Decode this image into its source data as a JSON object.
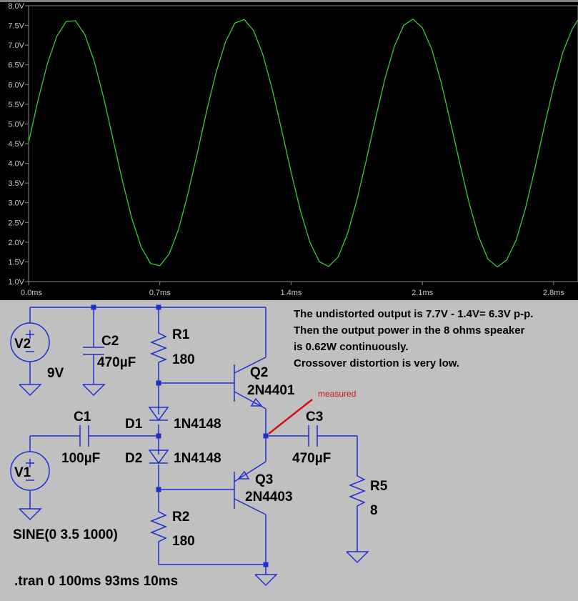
{
  "waveform": {
    "y_ticks": [
      "8.0V",
      "7.5V",
      "7.0V",
      "6.5V",
      "6.0V",
      "5.5V",
      "5.0V",
      "4.5V",
      "4.0V",
      "3.5V",
      "3.0V",
      "2.5V",
      "2.0V",
      "1.5V",
      "1.0V"
    ],
    "x_ticks": [
      "0.0ms",
      "0.7ms",
      "1.4ms",
      "2.1ms",
      "2.8ms"
    ]
  },
  "chart_data": {
    "type": "line",
    "title": "",
    "xlabel": "",
    "ylabel": "",
    "xlim": [
      0,
      2.93
    ],
    "ylim": [
      1.0,
      8.0
    ],
    "x_unit": "ms",
    "y_unit": "V",
    "trace_color": "#3cc83c",
    "background": "#000000",
    "series": [
      {
        "x": [
          0.0,
          0.05,
          0.1,
          0.15,
          0.2,
          0.25,
          0.3,
          0.35,
          0.4,
          0.45,
          0.5,
          0.55,
          0.6,
          0.65,
          0.7,
          0.75,
          0.8,
          0.85,
          0.9,
          0.95,
          1.0,
          1.05,
          1.1,
          1.15,
          1.2,
          1.25,
          1.3,
          1.35,
          1.4,
          1.45,
          1.5,
          1.55,
          1.6,
          1.65,
          1.7,
          1.75,
          1.8,
          1.85,
          1.9,
          1.95,
          2.0,
          2.05,
          2.1,
          2.15,
          2.2,
          2.25,
          2.3,
          2.35,
          2.4,
          2.45,
          2.5,
          2.55,
          2.6,
          2.65,
          2.7,
          2.75,
          2.8,
          2.85,
          2.9,
          2.93
        ],
        "y": [
          4.53,
          5.59,
          6.52,
          7.22,
          7.6,
          7.62,
          7.27,
          6.59,
          5.67,
          4.62,
          3.57,
          2.61,
          1.88,
          1.46,
          1.4,
          1.7,
          2.33,
          3.23,
          4.26,
          5.33,
          6.31,
          7.08,
          7.56,
          7.65,
          7.37,
          6.75,
          5.87,
          4.84,
          3.78,
          2.79,
          2.0,
          1.51,
          1.38,
          1.62,
          2.2,
          3.05,
          4.06,
          5.13,
          6.14,
          6.96,
          7.5,
          7.66,
          7.44,
          6.9,
          6.06,
          5.04,
          3.99,
          2.98,
          2.14,
          1.57,
          1.37,
          1.55,
          2.05,
          2.86,
          3.86,
          4.93,
          5.95,
          6.83,
          7.42,
          7.64
        ]
      }
    ]
  },
  "schematic": {
    "v2": {
      "name": "V2",
      "value": "9V"
    },
    "c2": {
      "name": "C2",
      "value": "470µF"
    },
    "r1": {
      "name": "R1",
      "value": "180"
    },
    "q2": {
      "name": "Q2",
      "value": "2N4401"
    },
    "d1": {
      "name": "D1",
      "value": "1N4148"
    },
    "d2": {
      "name": "D2",
      "value": "1N4148"
    },
    "c1": {
      "name": "C1",
      "value": "100µF"
    },
    "v1": {
      "name": "V1",
      "value": "SINE(0 3.5 1000)"
    },
    "q3": {
      "name": "Q3",
      "value": "2N4403"
    },
    "r2": {
      "name": "R2",
      "value": "180"
    },
    "c3": {
      "name": "C3",
      "value": "470µF"
    },
    "r5": {
      "name": "R5",
      "value": "8"
    },
    "directive": ".tran 0 100ms 93ms 10ms",
    "measured_label": "measured",
    "notes": [
      "The undistorted output is 7.7V -  1.4V= 6.3V p-p.",
      "Then the output power in the 8 ohms speaker",
      "is 0.62W continuously.",
      "Crossover distortion is very low."
    ]
  }
}
